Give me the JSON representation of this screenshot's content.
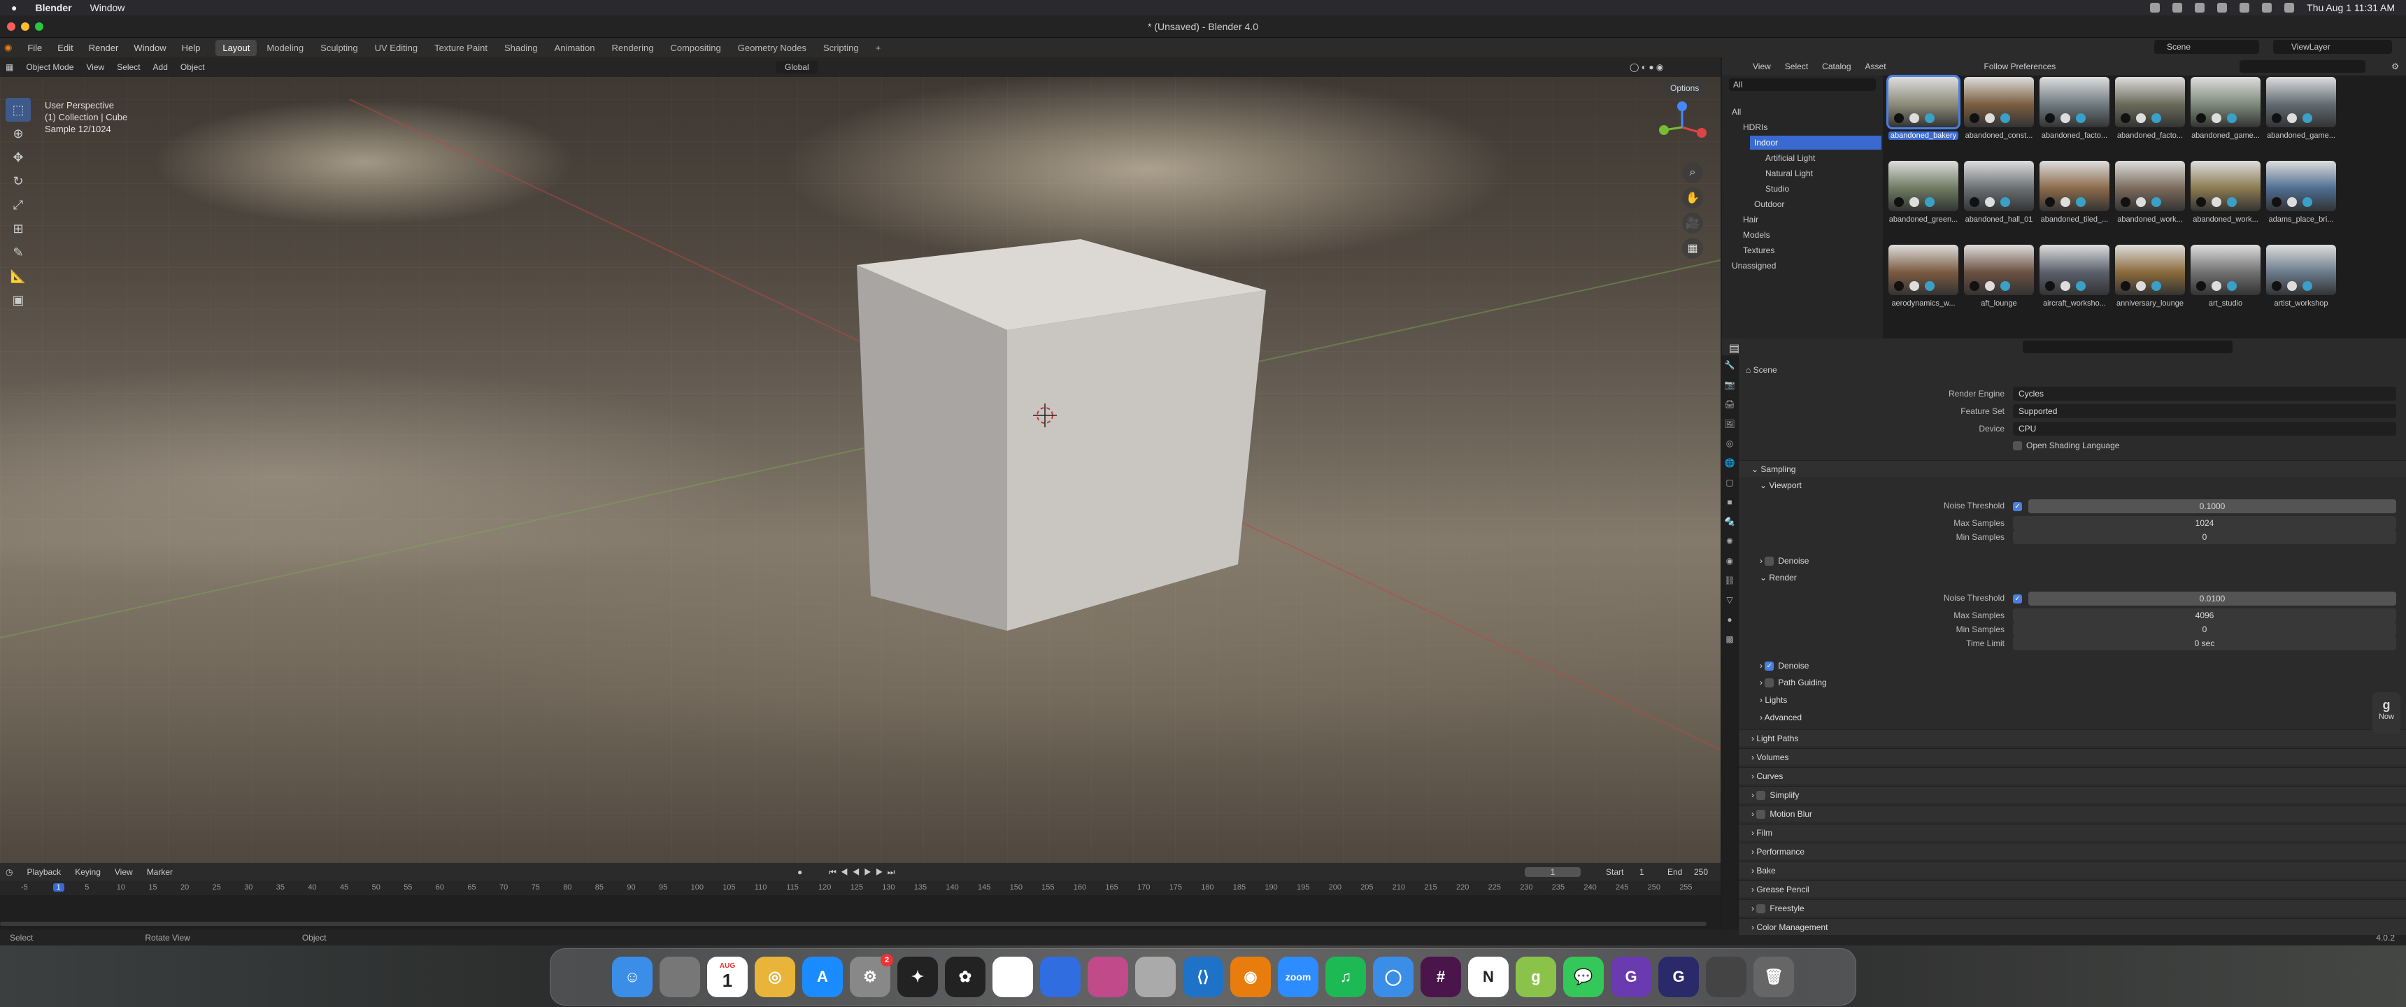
{
  "mac_menubar": {
    "app": "Blender",
    "menu": [
      "Window"
    ],
    "clock": "Thu Aug 1  11:31 AM"
  },
  "window": {
    "title": "* (Unsaved) - Blender 4.0"
  },
  "topbar": {
    "menus": [
      "File",
      "Edit",
      "Render",
      "Window",
      "Help"
    ],
    "workspaces": [
      "Layout",
      "Modeling",
      "Sculpting",
      "UV Editing",
      "Texture Paint",
      "Shading",
      "Animation",
      "Rendering",
      "Compositing",
      "Geometry Nodes",
      "Scripting"
    ],
    "active_workspace": "Layout",
    "add_tab": "+",
    "scene": "Scene",
    "view_layer": "ViewLayer"
  },
  "viewport": {
    "mode": "Object Mode",
    "menus": [
      "View",
      "Select",
      "Add",
      "Object"
    ],
    "orientation": "Global",
    "options": "Options",
    "overlay_lines": [
      "User Perspective",
      "(1) Collection | Cube",
      "Sample 12/1024"
    ]
  },
  "timeline": {
    "menus": [
      "Playback",
      "Keying",
      "View",
      "Marker"
    ],
    "current_frame": "1",
    "start_label": "Start",
    "start": "1",
    "end_label": "End",
    "end": "250",
    "ruler": [
      "-5",
      "1",
      "5",
      "10",
      "15",
      "20",
      "25",
      "30",
      "35",
      "40",
      "45",
      "50",
      "55",
      "60",
      "65",
      "70",
      "75",
      "80",
      "85",
      "90",
      "95",
      "100",
      "105",
      "110",
      "115",
      "120",
      "125",
      "130",
      "135",
      "140",
      "145",
      "150",
      "155",
      "160",
      "165",
      "170",
      "175",
      "180",
      "185",
      "190",
      "195",
      "200",
      "205",
      "210",
      "215",
      "220",
      "225",
      "230",
      "235",
      "240",
      "245",
      "250",
      "255"
    ]
  },
  "statusbar": {
    "items": [
      "Select",
      "Rotate View",
      "Object"
    ],
    "version": "4.0.2"
  },
  "asset_browser": {
    "menus": [
      "View",
      "Select",
      "Catalog",
      "Asset"
    ],
    "library": "Follow Preferences",
    "filter": "All",
    "tree": [
      {
        "label": "All",
        "depth": 0
      },
      {
        "label": "HDRIs",
        "depth": 1
      },
      {
        "label": "Indoor",
        "depth": 2,
        "selected": true
      },
      {
        "label": "Artificial Light",
        "depth": 3
      },
      {
        "label": "Natural Light",
        "depth": 3
      },
      {
        "label": "Studio",
        "depth": 3
      },
      {
        "label": "Outdoor",
        "depth": 2
      },
      {
        "label": "Hair",
        "depth": 1
      },
      {
        "label": "Models",
        "depth": 1
      },
      {
        "label": "Textures",
        "depth": 1
      },
      {
        "label": "Unassigned",
        "depth": 0
      }
    ],
    "assets": [
      "abandoned_bakery",
      "abandoned_const...",
      "abandoned_facto...",
      "abandoned_facto...",
      "abandoned_game...",
      "abandoned_game...",
      "abandoned_green...",
      "abandoned_hall_01",
      "abandoned_tiled_...",
      "abandoned_work...",
      "abandoned_work...",
      "adams_place_bri...",
      "aerodynamics_w...",
      "aft_lounge",
      "aircraft_worksho...",
      "anniversary_lounge",
      "art_studio",
      "artist_workshop"
    ]
  },
  "properties": {
    "context": "Scene",
    "render_engine": {
      "label": "Render Engine",
      "value": "Cycles"
    },
    "feature_set": {
      "label": "Feature Set",
      "value": "Supported"
    },
    "device": {
      "label": "Device",
      "value": "CPU"
    },
    "osl": "Open Shading Language",
    "sampling": "Sampling",
    "viewport": "Viewport",
    "vp_noise": {
      "label": "Noise Threshold",
      "value": "0.1000"
    },
    "vp_max": {
      "label": "Max Samples",
      "value": "1024"
    },
    "vp_min": {
      "label": "Min Samples",
      "value": "0"
    },
    "denoise": "Denoise",
    "render": "Render",
    "r_noise": {
      "label": "Noise Threshold",
      "value": "0.0100"
    },
    "r_max": {
      "label": "Max Samples",
      "value": "4096"
    },
    "r_min": {
      "label": "Min Samples",
      "value": "0"
    },
    "r_time": {
      "label": "Time Limit",
      "value": "0 sec"
    },
    "subs": [
      "Denoise",
      "Path Guiding",
      "Lights",
      "Advanced"
    ],
    "panels": [
      "Light Paths",
      "Volumes",
      "Curves",
      "Simplify",
      "Motion Blur",
      "Film",
      "Performance",
      "Bake",
      "Grease Pencil",
      "Freestyle",
      "Color Management"
    ]
  },
  "notification": {
    "label": "Now"
  },
  "dock": [
    "Finder",
    "Launchpad",
    "Calendar",
    "Chrome",
    "App Store",
    "System Settings",
    "Final Cut",
    "Figma",
    "Notes",
    "Docs",
    "Affinity",
    "DVD",
    "VS Code",
    "Blender",
    "Zoom",
    "Spotify",
    "Safari",
    "Slack",
    "Notion",
    "G",
    "Messages",
    "G",
    "G",
    "Screens",
    "Trash"
  ],
  "calendar": {
    "month": "AUG",
    "day": "1"
  },
  "dock_badge": "2"
}
